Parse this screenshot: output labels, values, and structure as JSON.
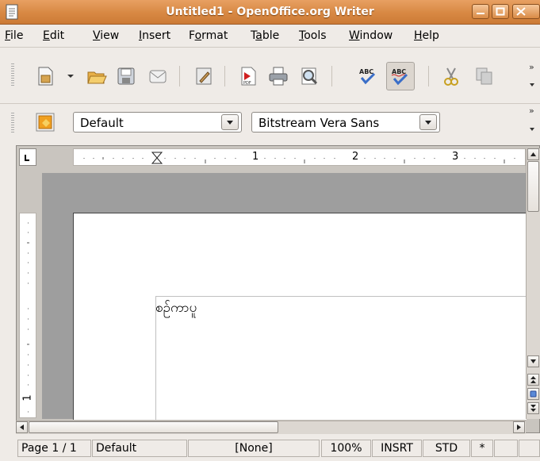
{
  "window": {
    "title": "Untitled1 - OpenOffice.org Writer"
  },
  "menubar": {
    "items": [
      "File",
      "Edit",
      "View",
      "Insert",
      "Format",
      "Table",
      "Tools",
      "Window",
      "Help"
    ]
  },
  "toolbar": {
    "icons": [
      "new-document-icon",
      "dropdown-arrow-icon",
      "open-folder-icon",
      "save-icon",
      "email-icon",
      "edit-file-icon",
      "export-pdf-icon",
      "print-icon",
      "page-preview-icon",
      "spellcheck-icon",
      "autospellcheck-icon",
      "cut-icon",
      "copy-icon"
    ],
    "overflow": "»"
  },
  "formatting": {
    "style_value": "Default",
    "font_value": "Bitstream Vera Sans",
    "overflow": "»"
  },
  "ruler": {
    "ticks": [
      "1",
      "2",
      "3"
    ],
    "vticks": [
      "1"
    ]
  },
  "document": {
    "text": "စဉ်ကာပူ"
  },
  "statusbar": {
    "page": "Page 1 / 1",
    "style": "Default",
    "language": "[None]",
    "zoom": "100%",
    "insert_mode": "INSRT",
    "selection_mode": "STD",
    "modified": "*"
  },
  "colors": {
    "titlebar": "#d98a45",
    "page": "#ffffff",
    "canvas": "#9e9e9e"
  }
}
